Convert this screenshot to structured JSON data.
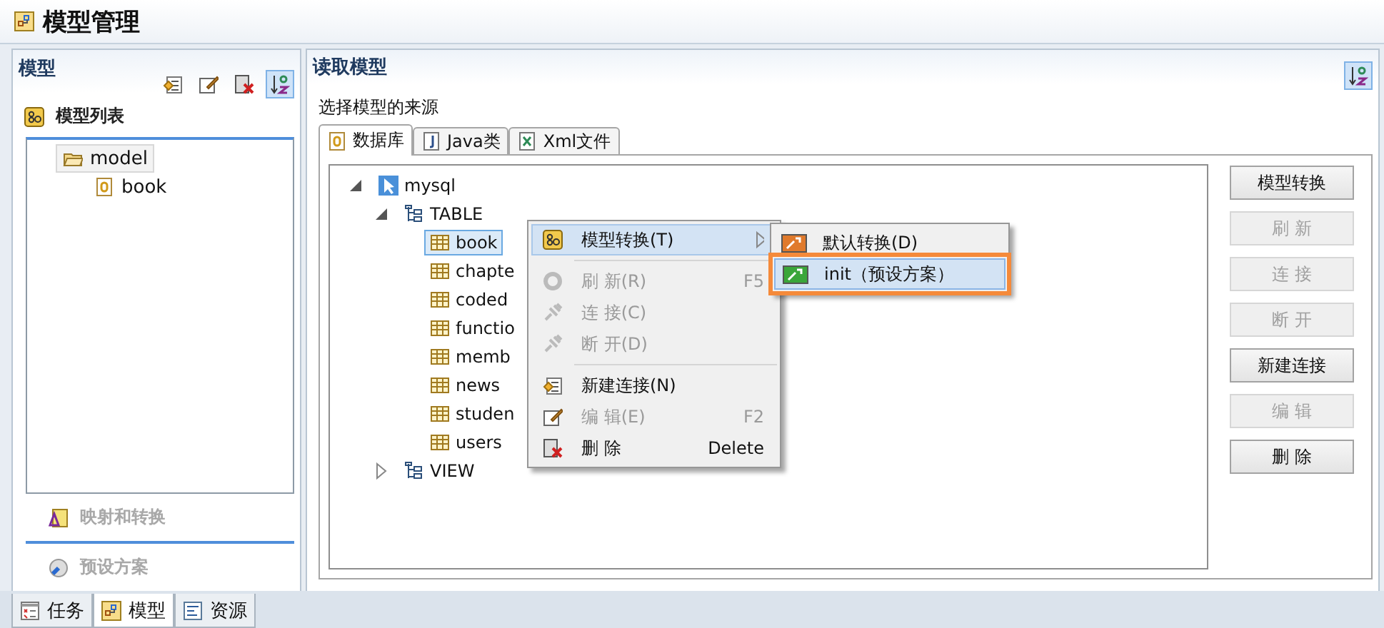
{
  "window": {
    "title": "模型管理"
  },
  "left_panel": {
    "title": "模型",
    "toolbar": [
      {
        "kind": "new-connection",
        "selected": false
      },
      {
        "kind": "edit",
        "selected": false
      },
      {
        "kind": "delete",
        "selected": false
      },
      {
        "kind": "sort",
        "selected": true
      }
    ],
    "sections": [
      {
        "title": "模型列表",
        "disabled": false,
        "tree": [
          {
            "label": "model",
            "kind": "folder",
            "selected": true,
            "children": [
              {
                "label": "book",
                "kind": "file",
                "selected": false
              }
            ]
          }
        ]
      },
      {
        "title": "映射和转换",
        "disabled": true
      },
      {
        "title": "预设方案",
        "disabled": true
      }
    ]
  },
  "bottom_tabs": [
    {
      "label": "任务",
      "kind": "tasks",
      "selected": false
    },
    {
      "label": "模型",
      "kind": "model",
      "selected": true
    },
    {
      "label": "资源",
      "kind": "resources",
      "selected": false
    }
  ],
  "right_panel": {
    "title": "读取模型",
    "sort_selected": true,
    "source_label": "选择模型的来源",
    "tabs": [
      {
        "label": "数据库",
        "kind": "database",
        "selected": true
      },
      {
        "label": "Java类",
        "kind": "java",
        "selected": false
      },
      {
        "label": "Xml文件",
        "kind": "xml",
        "selected": false
      }
    ],
    "tree": [
      {
        "label": "mysql",
        "kind": "connection",
        "expanded": true,
        "selected": false,
        "children": [
          {
            "label": "TABLE",
            "kind": "group",
            "expanded": true,
            "selected": false,
            "children": [
              {
                "label": "book",
                "kind": "table",
                "selected": true
              },
              {
                "label": "chapte",
                "kind": "table",
                "selected": false
              },
              {
                "label": "coded",
                "kind": "table",
                "selected": false
              },
              {
                "label": "functio",
                "kind": "table",
                "selected": false
              },
              {
                "label": "memb",
                "kind": "table",
                "selected": false
              },
              {
                "label": "news",
                "kind": "table",
                "selected": false
              },
              {
                "label": "studen",
                "kind": "table",
                "selected": false
              },
              {
                "label": "users",
                "kind": "table",
                "selected": false
              }
            ]
          },
          {
            "label": "VIEW",
            "kind": "group",
            "expanded": false,
            "selected": false
          }
        ]
      }
    ],
    "buttons": [
      {
        "label": "模型转换",
        "disabled": false
      },
      {
        "label": "刷 新",
        "disabled": true
      },
      {
        "label": "连 接",
        "disabled": true
      },
      {
        "label": "断 开",
        "disabled": true
      },
      {
        "label": "新建连接",
        "disabled": false
      },
      {
        "label": "编 辑",
        "disabled": true
      },
      {
        "label": "删 除",
        "disabled": false
      }
    ]
  },
  "context_menu": {
    "items": [
      {
        "kind": "item",
        "label": "模型转换(T)",
        "disabled": false,
        "highlighted": true,
        "submenu": true
      },
      {
        "kind": "separator"
      },
      {
        "kind": "item",
        "label": "刷 新(R)",
        "shortcut": "F5",
        "disabled": true,
        "highlighted": false,
        "submenu": false
      },
      {
        "kind": "item",
        "label": "连 接(C)",
        "disabled": true,
        "highlighted": false,
        "submenu": false
      },
      {
        "kind": "item",
        "label": "断 开(D)",
        "disabled": true,
        "highlighted": false,
        "submenu": false
      },
      {
        "kind": "separator"
      },
      {
        "kind": "item",
        "label": "新建连接(N)",
        "disabled": false,
        "highlighted": false,
        "submenu": false
      },
      {
        "kind": "item",
        "label": "编 辑(E)",
        "shortcut": "F2",
        "disabled": true,
        "highlighted": false,
        "submenu": false
      },
      {
        "kind": "item",
        "label": "删 除",
        "shortcut": "Delete",
        "disabled": false,
        "highlighted": false,
        "submenu": false
      }
    ],
    "submenu": [
      {
        "label": "默认转换(D)",
        "color": "#e07a2c",
        "highlighted": false,
        "outlined": false
      },
      {
        "label": "init（预设方案）",
        "color": "#3aa63a",
        "highlighted": true,
        "outlined": true
      }
    ]
  }
}
